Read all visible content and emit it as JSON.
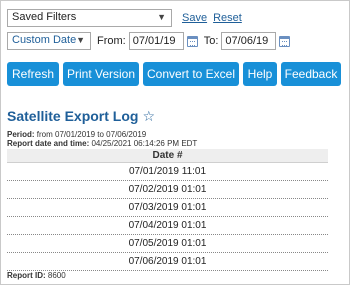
{
  "filters": {
    "saved_filters_value": "Saved Filters",
    "save_label": "Save",
    "reset_label": "Reset"
  },
  "date_range": {
    "range_value": "Custom Date",
    "from_label": "From:",
    "from_value": "07/01/19",
    "to_label": "To:",
    "to_value": "07/06/19"
  },
  "toolbar": {
    "buttons": [
      "Refresh",
      "Print Version",
      "Convert to Excel",
      "Help",
      "Feedback"
    ]
  },
  "report": {
    "title": "Satellite Export Log",
    "period_label": "Period:",
    "period_value": "from 07/01/2019 to 07/06/2019",
    "date_label": "Report date and time:",
    "date_value": "04/25/2021 06:14:26 PM EDT",
    "column_header": "Date #",
    "rows": [
      "07/01/2019 11:01",
      "07/02/2019 01:01",
      "07/03/2019 01:01",
      "07/04/2019 01:01",
      "07/05/2019 01:01",
      "07/06/2019 01:01"
    ],
    "report_id_label": "Report ID:",
    "report_id_value": "8600"
  },
  "colors": {
    "button_bg": "#1890d8",
    "title_color": "#1f5f99",
    "link_color": "#1f5f99"
  },
  "icons": {
    "dropdown": "chevron-down-icon",
    "calendar": "calendar-icon",
    "favorite": "star-outline-icon"
  }
}
